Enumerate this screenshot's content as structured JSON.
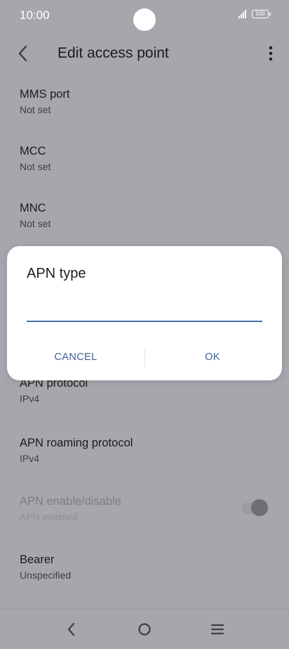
{
  "status_bar": {
    "time": "10:00",
    "battery_level": "100"
  },
  "header": {
    "title": "Edit access point"
  },
  "settings": [
    {
      "title": "MMS port",
      "summary": "Not set"
    },
    {
      "title": "MCC",
      "summary": "Not set"
    },
    {
      "title": "MNC",
      "summary": "Not set"
    },
    {
      "title": "APN protocol",
      "summary": "IPv4"
    },
    {
      "title": "APN roaming protocol",
      "summary": "IPv4"
    },
    {
      "title": "APN enable/disable",
      "summary": "APN enabled",
      "enabled": false,
      "toggle_on": true
    },
    {
      "title": "Bearer",
      "summary": "Unspecified"
    }
  ],
  "dialog": {
    "title": "APN type",
    "input_value": "",
    "cancel_label": "CANCEL",
    "ok_label": "OK"
  },
  "nav_bar": {
    "buttons": [
      "back-icon",
      "home-icon",
      "recents-icon"
    ]
  },
  "colors": {
    "scrim_background": "#a6a6ad",
    "dialog_background": "#ffffff",
    "accent": "#3f5f93",
    "input_underline": "#4a6fa8"
  }
}
